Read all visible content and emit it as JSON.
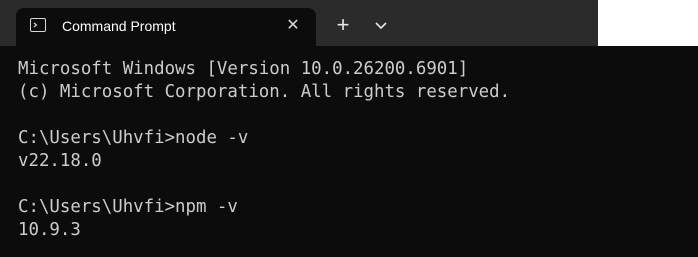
{
  "window": {
    "tab_title": "Command Prompt",
    "tab_icon": "terminal-icon",
    "close_icon": "close-icon",
    "close_glyph": "✕",
    "new_tab_icon": "plus-icon",
    "new_tab_glyph": "+",
    "dropdown_icon": "chevron-down-icon"
  },
  "colors": {
    "background": "#0c0c0c",
    "tabbar": "#2b2b2b",
    "text": "#cccccc"
  },
  "console": {
    "lines": [
      "Microsoft Windows [Version 10.0.26200.6901]",
      "(c) Microsoft Corporation. All rights reserved.",
      "",
      "C:\\Users\\Uhvfi>node -v",
      "v22.18.0",
      "",
      "C:\\Users\\Uhvfi>npm -v",
      "10.9.3"
    ]
  }
}
